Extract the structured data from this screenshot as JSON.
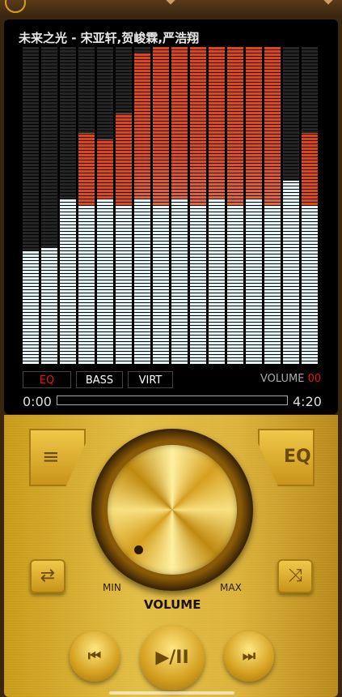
{
  "player": {
    "song_title": "未来之光  -  宋亚轩,贺峻霖,严浩翔",
    "time_elapsed": "0:00",
    "time_total": "4:20"
  },
  "equalizer": {
    "levels": [
      0.36,
      0.37,
      0.52,
      0.73,
      0.71,
      0.79,
      0.98,
      1.0,
      1.0,
      1.0,
      1.0,
      1.0,
      1.0,
      1.0,
      0.58,
      0.73
    ],
    "peaks": [
      0.64,
      0.64,
      0.52,
      0.5,
      0.52,
      0.5,
      0.52,
      0.5,
      0.52,
      0.5,
      0.52,
      0.5,
      0.52,
      0.5,
      0.6,
      0.5
    ],
    "colors": {
      "background": "#262626",
      "peak_top": "#e8420e",
      "fill": "#dff4f4"
    }
  },
  "chips": {
    "eq": "EQ",
    "bass": "BASS",
    "virt": "VIRT"
  },
  "volume": {
    "label": "VOLUME",
    "value": "00",
    "knob_title": "VOLUME",
    "min": "MIN",
    "max": "MAX"
  },
  "buttons": {
    "menu_icon": "list-icon",
    "eq_label": "EQ",
    "repeat_icon": "repeat-icon",
    "shuffle_icon": "shuffle-icon",
    "prev_icon": "previous-icon",
    "play_label": "▶/II",
    "next_icon": "next-icon"
  },
  "theme": {
    "gold": "#d4a017",
    "accent_red": "#ee1111"
  }
}
